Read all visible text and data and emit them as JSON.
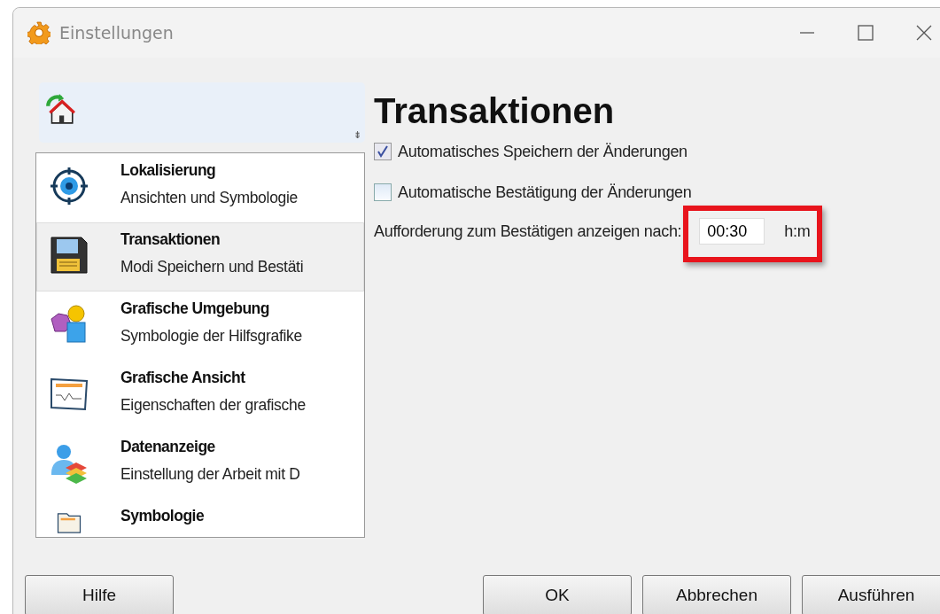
{
  "window": {
    "title": "Einstellungen"
  },
  "nav_header": {
    "collapse_glyph": "⇟"
  },
  "nav_items": [
    {
      "title": "Lokalisierung",
      "subtitle": "Ansichten und Symbologie",
      "selected": false
    },
    {
      "title": "Transaktionen",
      "subtitle": "Modi Speichern und Bestäti",
      "selected": true
    },
    {
      "title": "Grafische Umgebung",
      "subtitle": "Symbologie der Hilfsgrafike",
      "selected": false
    },
    {
      "title": "Grafische Ansicht",
      "subtitle": "Eigenschaften der grafische",
      "selected": false
    },
    {
      "title": "Datenanzeige",
      "subtitle": "Einstellung der Arbeit mit D",
      "selected": false
    },
    {
      "title": "Symbologie",
      "selected": false
    }
  ],
  "page": {
    "heading": "Transaktionen",
    "options": [
      {
        "label": "Automatisches Speichern der Änderungen",
        "checked": true
      },
      {
        "label": "Automatische Bestätigung der Änderungen",
        "checked": false
      }
    ],
    "delay": {
      "label": "Aufforderung zum Bestätigen anzeigen nach:",
      "value": "00:30",
      "unit": "h:m",
      "highlighted": true
    }
  },
  "buttons": {
    "help": "Hilfe",
    "actions": [
      "OK",
      "Abbrechen",
      "Ausführen"
    ]
  }
}
